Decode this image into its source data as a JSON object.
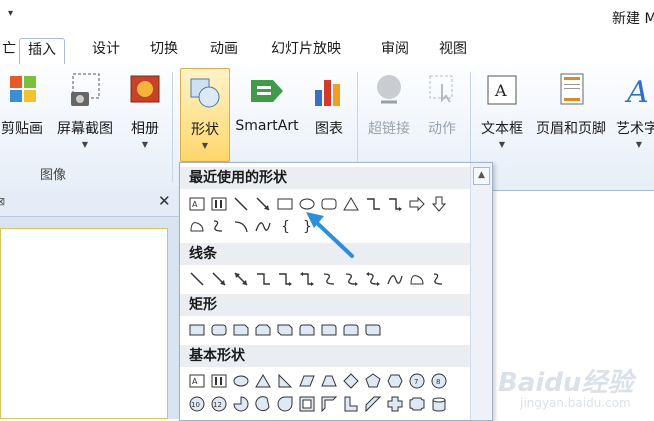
{
  "window": {
    "title": "新建 M"
  },
  "tabs": [
    {
      "label": "亡"
    },
    {
      "label": "插入"
    },
    {
      "label": "设计"
    },
    {
      "label": "切换"
    },
    {
      "label": "动画"
    },
    {
      "label": "幻灯片放映"
    },
    {
      "label": "审阅"
    },
    {
      "label": "视图"
    }
  ],
  "ribbon": {
    "clipart": "剪贴画",
    "screenshot": "屏幕截图",
    "album": "相册",
    "shapes": "形状",
    "smartart": "SmartArt",
    "chart": "图表",
    "hyperlink": "超链接",
    "action": "动作",
    "textbox": "文本框",
    "header_footer": "页眉和页脚",
    "wordart": "艺术字",
    "group_images": "图像"
  },
  "gallery": {
    "sections": [
      {
        "title": "最近使用的形状"
      },
      {
        "title": "线条"
      },
      {
        "title": "矩形"
      },
      {
        "title": "基本形状"
      }
    ]
  },
  "watermark": {
    "main": "Baidu经验",
    "sub": "jingyan.baidu.com"
  },
  "colors": {
    "accent": "#ffd66b",
    "ribbon_bg": "#e6eef8",
    "annotation_arrow": "#2a8fdc"
  }
}
